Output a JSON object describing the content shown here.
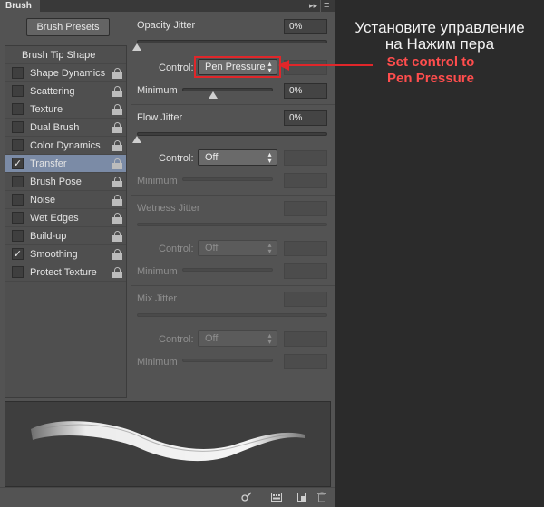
{
  "panel": {
    "tab_title": "Brush",
    "presets_button": "Brush Presets",
    "list_header": "Brush Tip Shape",
    "items": [
      {
        "label": "Shape Dynamics",
        "checked": false,
        "selected": false
      },
      {
        "label": "Scattering",
        "checked": false,
        "selected": false
      },
      {
        "label": "Texture",
        "checked": false,
        "selected": false
      },
      {
        "label": "Dual Brush",
        "checked": false,
        "selected": false
      },
      {
        "label": "Color Dynamics",
        "checked": false,
        "selected": false
      },
      {
        "label": "Transfer",
        "checked": true,
        "selected": true
      },
      {
        "label": "Brush Pose",
        "checked": false,
        "selected": false
      },
      {
        "label": "Noise",
        "checked": false,
        "selected": false
      },
      {
        "label": "Wet Edges",
        "checked": false,
        "selected": false
      },
      {
        "label": "Build-up",
        "checked": false,
        "selected": false
      },
      {
        "label": "Smoothing",
        "checked": true,
        "selected": false
      },
      {
        "label": "Protect Texture",
        "checked": false,
        "selected": false
      }
    ],
    "checkmark_glyph": "✓"
  },
  "settings": {
    "opacity_jitter": {
      "label": "Opacity Jitter",
      "value": "0%",
      "level": 0
    },
    "control_label": "Control:",
    "opacity_control": "Pen Pressure",
    "minimum_label": "Minimum",
    "opacity_minimum": {
      "value": "0%",
      "level": 0.34
    },
    "flow_jitter": {
      "label": "Flow Jitter",
      "value": "0%",
      "level": 0
    },
    "flow_control": "Off",
    "wetness_jitter": {
      "label": "Wetness Jitter"
    },
    "wetness_control": "Off",
    "mix_jitter": {
      "label": "Mix Jitter"
    },
    "mix_control": "Off"
  },
  "annotation": {
    "russian_line1": "Установите управление",
    "russian_line2": "на Нажим пера",
    "english_line1": "Set control to",
    "english_line2": "Pen Pressure",
    "highlight_color": "#e0262a",
    "label_color": "#ff4d4d"
  },
  "icons": {
    "forward_icon": "▸▸",
    "menu_icon": "≡",
    "select_arrows": "▴▾"
  },
  "colors": {
    "panel_bg": "#535353",
    "selected_row": "#7b8ba6",
    "page_bg": "#2b2b2b"
  }
}
